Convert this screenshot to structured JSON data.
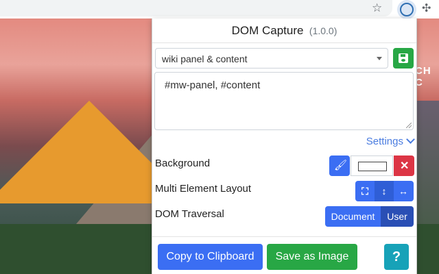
{
  "popup": {
    "title": "DOM Capture",
    "version": "(1.0.0)",
    "preset": {
      "selected": "wiki panel & content"
    },
    "selector_text": "#mw-panel, #content",
    "settings_label": "Settings",
    "background_label": "Background",
    "multi_layout_label": "Multi Element Layout",
    "dom_traversal_label": "DOM Traversal",
    "traversal": {
      "document": "Document",
      "user": "User"
    },
    "copy_label": "Copy to Clipboard",
    "save_image_label": "Save as Image",
    "help_label": "?"
  },
  "browser": {
    "nav_fragment": "CH C"
  },
  "colors": {
    "primary": "#3b6ef3",
    "success": "#28a745",
    "danger": "#dc3545",
    "info": "#17a2b8",
    "link": "#4a7ce0"
  },
  "icons": [
    "star-icon",
    "dom-capture-extension-icon",
    "puzzle-icon",
    "caret-down-icon",
    "floppy-save-icon",
    "paint-brush-icon",
    "close-icon",
    "expand-icon",
    "vertical-arrows-icon",
    "horizontal-arrows-icon",
    "chevron-down-icon"
  ]
}
